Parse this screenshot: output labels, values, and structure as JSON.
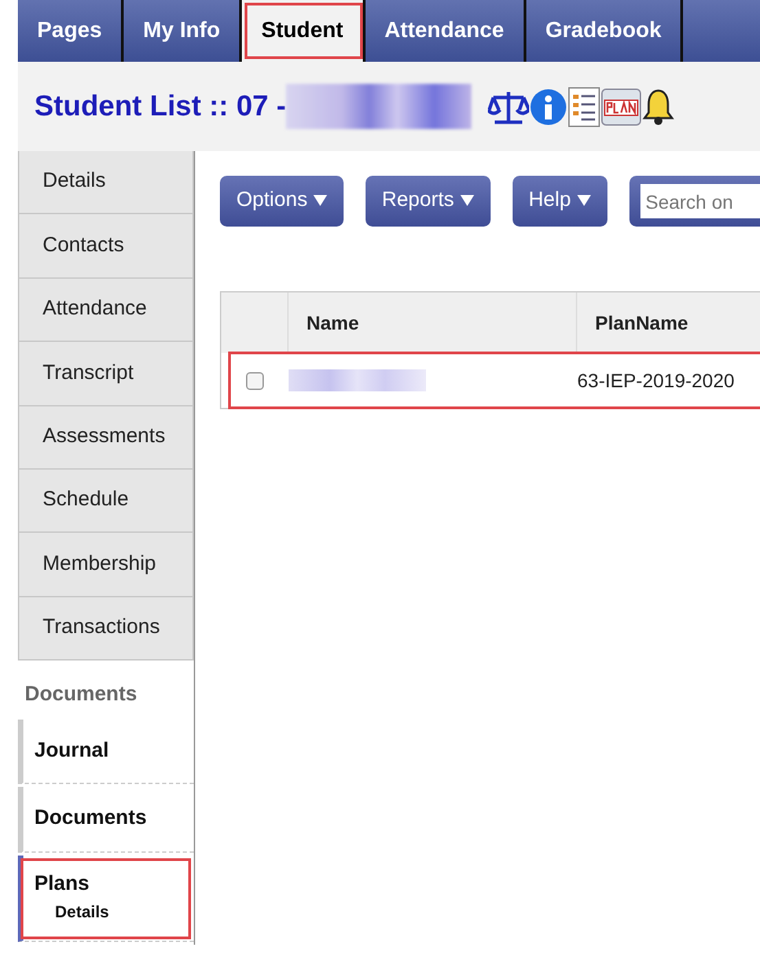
{
  "top_tabs": [
    {
      "label": "Pages",
      "selected": false,
      "highlighted": false
    },
    {
      "label": "My Info",
      "selected": false,
      "highlighted": false
    },
    {
      "label": "Student",
      "selected": true,
      "highlighted": true
    },
    {
      "label": "Attendance",
      "selected": false,
      "highlighted": false
    },
    {
      "label": "Gradebook",
      "selected": false,
      "highlighted": false
    }
  ],
  "header": {
    "title": "Student List :: 07 -"
  },
  "sidebar": {
    "items": [
      {
        "label": "Details",
        "selected": false
      },
      {
        "label": "Contacts",
        "selected": false
      },
      {
        "label": "Attendance",
        "selected": false
      },
      {
        "label": "Transcript",
        "selected": false
      },
      {
        "label": "Assessments",
        "selected": false
      },
      {
        "label": "Schedule",
        "selected": false
      },
      {
        "label": "Membership",
        "selected": false
      },
      {
        "label": "Transactions",
        "selected": false
      }
    ],
    "section": {
      "title": "Documents",
      "items": [
        {
          "label": "Journal",
          "selected": false,
          "highlighted": false
        },
        {
          "label": "Documents",
          "selected": false,
          "highlighted": false
        },
        {
          "label": "Plans",
          "selected": true,
          "highlighted": true,
          "children": [
            {
              "label": "Details"
            }
          ]
        }
      ]
    }
  },
  "toolbar": {
    "buttons": [
      {
        "label": "Options"
      },
      {
        "label": "Reports"
      },
      {
        "label": "Help"
      }
    ],
    "search": {
      "placeholder": "Search on"
    }
  },
  "table": {
    "columns": [
      "Name",
      "PlanName"
    ],
    "rows": [
      {
        "checked": false,
        "highlighted": true,
        "plan_name": "63-IEP-2019-2020"
      }
    ]
  }
}
